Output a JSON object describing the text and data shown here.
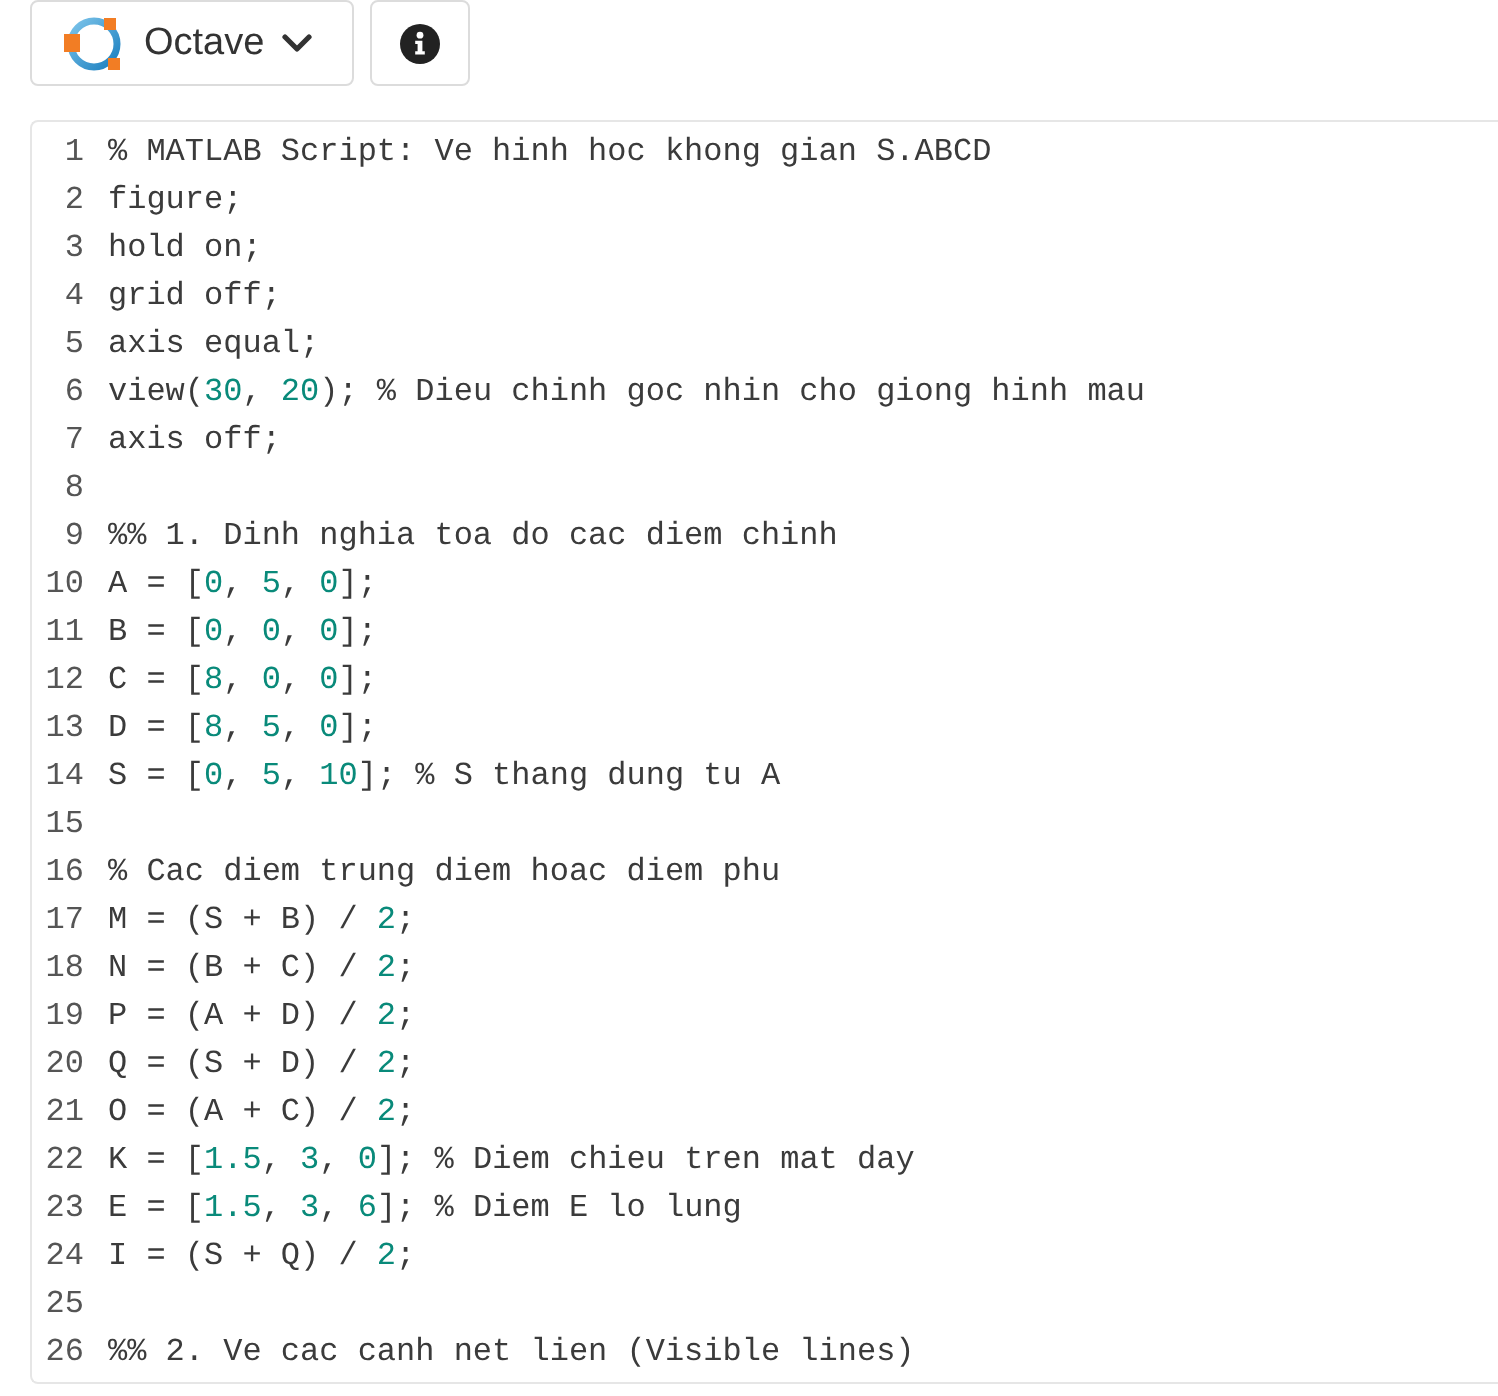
{
  "toolbar": {
    "language_button": {
      "label": "Octave"
    }
  },
  "editor": {
    "lines": [
      {
        "number": "1",
        "tokens": [
          {
            "text": "% MATLAB Script: Ve hinh hoc khong gian S.ABCD",
            "kind": "plain"
          }
        ]
      },
      {
        "number": "2",
        "tokens": [
          {
            "text": "figure;",
            "kind": "plain"
          }
        ]
      },
      {
        "number": "3",
        "tokens": [
          {
            "text": "hold on;",
            "kind": "plain"
          }
        ]
      },
      {
        "number": "4",
        "tokens": [
          {
            "text": "grid off;",
            "kind": "plain"
          }
        ]
      },
      {
        "number": "5",
        "tokens": [
          {
            "text": "axis equal;",
            "kind": "plain"
          }
        ]
      },
      {
        "number": "6",
        "tokens": [
          {
            "text": "view(",
            "kind": "plain"
          },
          {
            "text": "30",
            "kind": "number"
          },
          {
            "text": ", ",
            "kind": "plain"
          },
          {
            "text": "20",
            "kind": "number"
          },
          {
            "text": "); % Dieu chinh goc nhin cho giong hinh mau",
            "kind": "plain"
          }
        ]
      },
      {
        "number": "7",
        "tokens": [
          {
            "text": "axis off;",
            "kind": "plain"
          }
        ]
      },
      {
        "number": "8"
      },
      {
        "number": "9",
        "tokens": [
          {
            "text": "%% 1. Dinh nghia toa do cac diem chinh",
            "kind": "plain"
          }
        ]
      },
      {
        "number": "10",
        "tokens": [
          {
            "text": "A = [",
            "kind": "plain"
          },
          {
            "text": "0",
            "kind": "number"
          },
          {
            "text": ", ",
            "kind": "plain"
          },
          {
            "text": "5",
            "kind": "number"
          },
          {
            "text": ", ",
            "kind": "plain"
          },
          {
            "text": "0",
            "kind": "number"
          },
          {
            "text": "];",
            "kind": "plain"
          }
        ]
      },
      {
        "number": "11",
        "tokens": [
          {
            "text": "B = [",
            "kind": "plain"
          },
          {
            "text": "0",
            "kind": "number"
          },
          {
            "text": ", ",
            "kind": "plain"
          },
          {
            "text": "0",
            "kind": "number"
          },
          {
            "text": ", ",
            "kind": "plain"
          },
          {
            "text": "0",
            "kind": "number"
          },
          {
            "text": "];",
            "kind": "plain"
          }
        ]
      },
      {
        "number": "12",
        "tokens": [
          {
            "text": "C = [",
            "kind": "plain"
          },
          {
            "text": "8",
            "kind": "number"
          },
          {
            "text": ", ",
            "kind": "plain"
          },
          {
            "text": "0",
            "kind": "number"
          },
          {
            "text": ", ",
            "kind": "plain"
          },
          {
            "text": "0",
            "kind": "number"
          },
          {
            "text": "];",
            "kind": "plain"
          }
        ]
      },
      {
        "number": "13",
        "tokens": [
          {
            "text": "D = [",
            "kind": "plain"
          },
          {
            "text": "8",
            "kind": "number"
          },
          {
            "text": ", ",
            "kind": "plain"
          },
          {
            "text": "5",
            "kind": "number"
          },
          {
            "text": ", ",
            "kind": "plain"
          },
          {
            "text": "0",
            "kind": "number"
          },
          {
            "text": "];",
            "kind": "plain"
          }
        ]
      },
      {
        "number": "14",
        "tokens": [
          {
            "text": "S = [",
            "kind": "plain"
          },
          {
            "text": "0",
            "kind": "number"
          },
          {
            "text": ", ",
            "kind": "plain"
          },
          {
            "text": "5",
            "kind": "number"
          },
          {
            "text": ", ",
            "kind": "plain"
          },
          {
            "text": "10",
            "kind": "number"
          },
          {
            "text": "]; % S thang dung tu A",
            "kind": "plain"
          }
        ]
      },
      {
        "number": "15"
      },
      {
        "number": "16",
        "tokens": [
          {
            "text": "% Cac diem trung diem hoac diem phu",
            "kind": "plain"
          }
        ]
      },
      {
        "number": "17",
        "tokens": [
          {
            "text": "M = (S + B) / ",
            "kind": "plain"
          },
          {
            "text": "2",
            "kind": "number"
          },
          {
            "text": ";",
            "kind": "plain"
          }
        ]
      },
      {
        "number": "18",
        "tokens": [
          {
            "text": "N = (B + C) / ",
            "kind": "plain"
          },
          {
            "text": "2",
            "kind": "number"
          },
          {
            "text": ";",
            "kind": "plain"
          }
        ]
      },
      {
        "number": "19",
        "tokens": [
          {
            "text": "P = (A + D) / ",
            "kind": "plain"
          },
          {
            "text": "2",
            "kind": "number"
          },
          {
            "text": ";",
            "kind": "plain"
          }
        ]
      },
      {
        "number": "20",
        "tokens": [
          {
            "text": "Q = (S + D) / ",
            "kind": "plain"
          },
          {
            "text": "2",
            "kind": "number"
          },
          {
            "text": ";",
            "kind": "plain"
          }
        ]
      },
      {
        "number": "21",
        "tokens": [
          {
            "text": "O = (A + C) / ",
            "kind": "plain"
          },
          {
            "text": "2",
            "kind": "number"
          },
          {
            "text": ";",
            "kind": "plain"
          }
        ]
      },
      {
        "number": "22",
        "tokens": [
          {
            "text": "K = [",
            "kind": "plain"
          },
          {
            "text": "1.5",
            "kind": "number"
          },
          {
            "text": ", ",
            "kind": "plain"
          },
          {
            "text": "3",
            "kind": "number"
          },
          {
            "text": ", ",
            "kind": "plain"
          },
          {
            "text": "0",
            "kind": "number"
          },
          {
            "text": "]; % Diem chieu tren mat day",
            "kind": "plain"
          }
        ]
      },
      {
        "number": "23",
        "tokens": [
          {
            "text": "E = [",
            "kind": "plain"
          },
          {
            "text": "1.5",
            "kind": "number"
          },
          {
            "text": ", ",
            "kind": "plain"
          },
          {
            "text": "3",
            "kind": "number"
          },
          {
            "text": ", ",
            "kind": "plain"
          },
          {
            "text": "6",
            "kind": "number"
          },
          {
            "text": "]; % Diem E lo lung",
            "kind": "plain"
          }
        ]
      },
      {
        "number": "24",
        "tokens": [
          {
            "text": "I = (S + Q) / ",
            "kind": "plain"
          },
          {
            "text": "2",
            "kind": "number"
          },
          {
            "text": ";",
            "kind": "plain"
          }
        ]
      },
      {
        "number": "25"
      },
      {
        "number": "26",
        "tokens": [
          {
            "text": "%% 2. Ve cac canh net lien (Visible lines)",
            "kind": "plain"
          }
        ]
      }
    ]
  }
}
